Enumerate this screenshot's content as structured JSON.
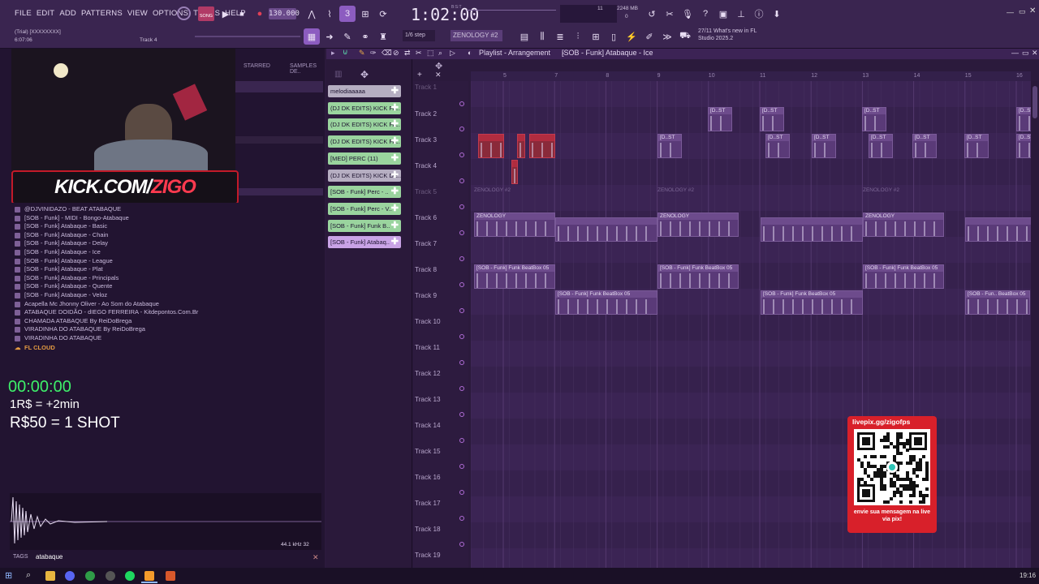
{
  "menu": {
    "items": [
      "FILE",
      "EDIT",
      "ADD",
      "PATTERNS",
      "VIEW",
      "OPTIONS",
      "TOOLS",
      "HELP"
    ]
  },
  "transport": {
    "song_mode": "SONG",
    "tempo": "130.000",
    "time": "1:02:00",
    "bst": "B:S:T",
    "time_sub": "11",
    "memory": "2248 MB",
    "cpu": "0",
    "snap": "1/6 step",
    "pattern": "ZENOLOGY #2"
  },
  "info": {
    "trial": "(Trial) [XXXXXXXX]",
    "trial_time": "6:07:06",
    "track_hint": "Track 4",
    "news_date": "27/11",
    "news_text": "What's new in FL Studio 2025.2"
  },
  "webcam": {
    "banner": "KICK.COM/",
    "banner_accent": "ZIGO"
  },
  "browser": {
    "tabs": [
      "STARRED",
      "SAMPLES DE.."
    ],
    "items": [
      "@DJVINIDAZO - BEAT ATABAQUE",
      "[SOB - Funk] - MIDI - Bongo-Atabaque",
      "[SOB - Funk] Atabaque - Basic",
      "[SOB - Funk] Atabaque - Chain",
      "[SOB - Funk] Atabaque - Delay",
      "[SOB - Funk] Atabaque - Ice",
      "[SOB - Funk] Atabaque - League",
      "[SOB - Funk] Atabaque - Plat",
      "[SOB - Funk] Atabaque - Principals",
      "[SOB - Funk] Atabaque - Quente",
      "[SOB - Funk] Atabaque - Veloz",
      "Acapella Mc Jhonny Oliver - Ao Som do Atabaque",
      "ATABAQUE DOIDÃO - dIEGO FERREIRA - Kitdepontos.Com.Br",
      "CHAMADA ATABAQUE By ReiDoBrega",
      "VIRADINHA DO ATABAQUE By ReiDoBrega",
      "VIRADINHA DO ATABAQUE"
    ],
    "cloud": "FL CLOUD"
  },
  "overlay": {
    "timer": "00:00:00",
    "line1": "1R$ = +2min",
    "line2": "R$50 = 1 SHOT"
  },
  "sample": {
    "rate": "44.1 kHz 32",
    "tags_label": "TAGS",
    "tags_value": "atabaque"
  },
  "channels": [
    "melodiaaaaa",
    "(DJ DK EDITS) KICK FA..",
    "(DJ DK EDITS) KICK FA..",
    "(DJ DK EDITS) KICK FA..",
    "[MED] PERC (11)",
    "(DJ DK EDITS) KICK DE..",
    "[SOB - Funk] Perc - ..",
    "[SOB - Funk] Perc - V..",
    "[SOB - Funk] Funk B..",
    "[SOB - Funk] Atabaq.."
  ],
  "playlist": {
    "title": "Playlist - Arrangement",
    "pattern_name": "[SOB - Funk] Atabaque - Ice",
    "ruler": [
      "5",
      "7",
      "8",
      "9",
      "10",
      "11",
      "12",
      "13",
      "14",
      "15",
      "16"
    ],
    "tracks": [
      "Track 1",
      "Track 2",
      "Track 3",
      "Track 4",
      "Track 5",
      "Track 6",
      "Track 7",
      "Track 8",
      "Track 9",
      "Track 10",
      "Track 11",
      "Track 12",
      "Track 13",
      "Track 14",
      "Track 15",
      "Track 16",
      "Track 17",
      "Track 18",
      "Track 19"
    ],
    "clip_labels": {
      "dst": "[D..ST",
      "zenology": "ZENOLOGY",
      "zenology2": "ZENOLOGY #2",
      "beatbox": "[SOB - Funk] Funk BeatBox 05",
      "beatbox_short": "[SOB - Fun.. BeatBox 05"
    }
  },
  "livepix": {
    "url": "livepix.gg/zigofps",
    "cta": "envie sua mensagem na live via pix!"
  },
  "clock": "19:16",
  "colors": {
    "accent": "#8c5cc0",
    "channel_green": "#9ad49e",
    "channel_gray": "#b6aec2",
    "clip": "#5a3a78",
    "red_clip": "#b12c3f",
    "livepix_red": "#d8202a"
  }
}
